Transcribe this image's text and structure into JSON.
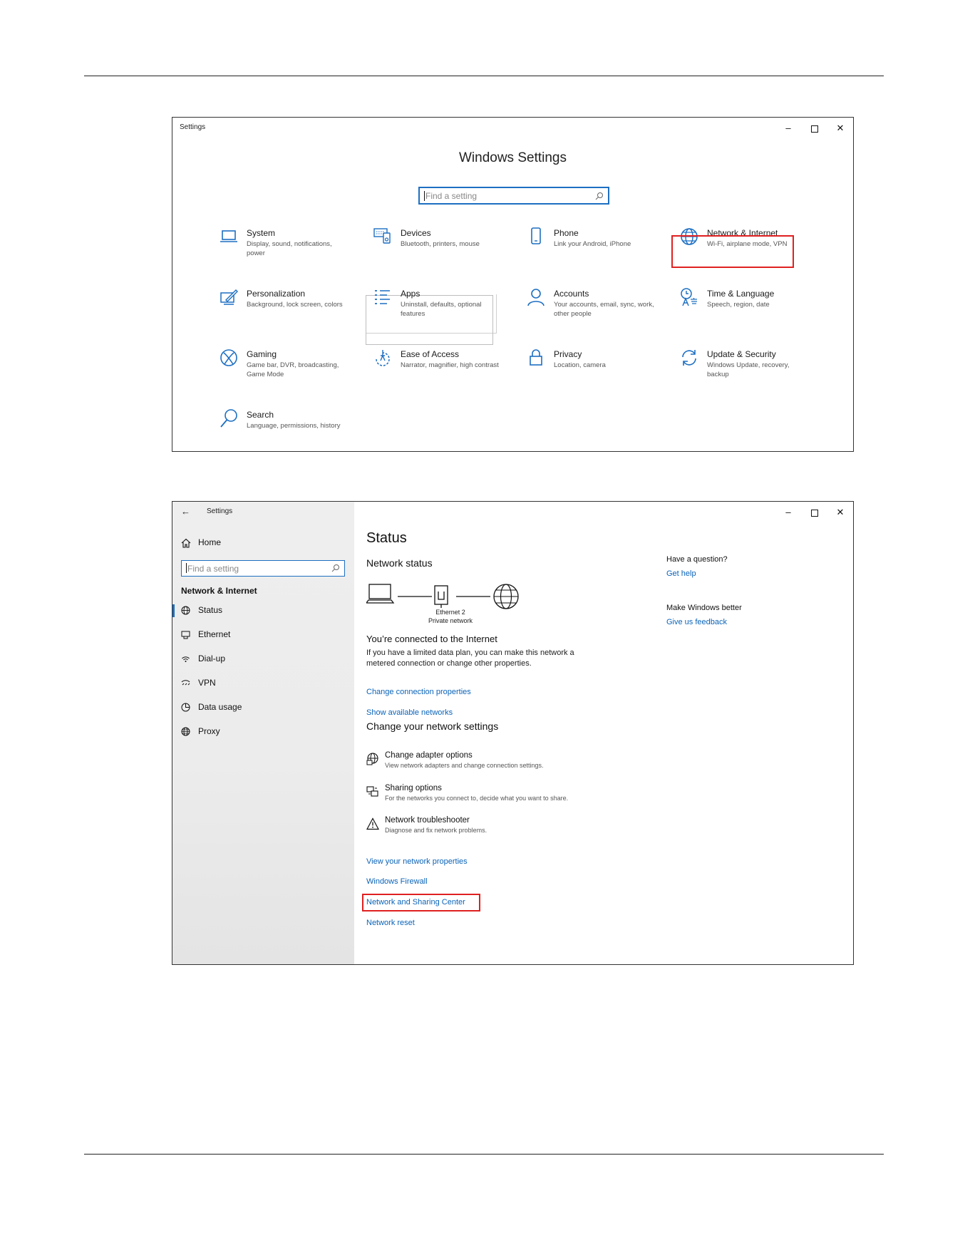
{
  "window1": {
    "title": "Settings",
    "heading": "Windows Settings",
    "search_placeholder": "Find a setting",
    "controls": {
      "minimize": "–",
      "close": "✕"
    },
    "tiles": [
      {
        "name": "System",
        "desc": "Display, sound, notifications, power",
        "icon": "laptop-icon"
      },
      {
        "name": "Devices",
        "desc": "Bluetooth, printers, mouse",
        "icon": "keyboard-icon"
      },
      {
        "name": "Phone",
        "desc": "Link your Android, iPhone",
        "icon": "phone-icon"
      },
      {
        "name": "Network & Internet",
        "desc": "Wi-Fi, airplane mode, VPN",
        "icon": "globe-icon"
      },
      {
        "name": "Personalization",
        "desc": "Background, lock screen, colors",
        "icon": "pen-tablet-icon"
      },
      {
        "name": "Apps",
        "desc": "Uninstall, defaults, optional features",
        "icon": "apps-list-icon"
      },
      {
        "name": "Accounts",
        "desc": "Your accounts, email, sync, work, other people",
        "icon": "person-icon"
      },
      {
        "name": "Time & Language",
        "desc": "Speech, region, date",
        "icon": "time-language-icon"
      },
      {
        "name": "Gaming",
        "desc": "Game bar, DVR, broadcasting, Game Mode",
        "icon": "xbox-icon"
      },
      {
        "name": "Ease of Access",
        "desc": "Narrator, magnifier, high contrast",
        "icon": "ease-of-access-icon"
      },
      {
        "name": "Privacy",
        "desc": "Location, camera",
        "icon": "lock-icon"
      },
      {
        "name": "Update & Security",
        "desc": "Windows Update, recovery, backup",
        "icon": "refresh-icon"
      },
      {
        "name": "Search",
        "desc": "Language, permissions, history",
        "icon": "search-icon"
      }
    ]
  },
  "window2": {
    "title": "Settings",
    "back_glyph": "←",
    "controls": {
      "minimize": "–",
      "close": "✕"
    },
    "sidebar": {
      "home_label": "Home",
      "search_placeholder": "Find a setting",
      "section": "Network & Internet",
      "items": [
        {
          "label": "Status",
          "icon": "status-icon",
          "selected": true
        },
        {
          "label": "Ethernet",
          "icon": "ethernet-icon",
          "selected": false
        },
        {
          "label": "Dial-up",
          "icon": "dialup-icon",
          "selected": false
        },
        {
          "label": "VPN",
          "icon": "vpn-icon",
          "selected": false
        },
        {
          "label": "Data usage",
          "icon": "data-usage-icon",
          "selected": false
        },
        {
          "label": "Proxy",
          "icon": "globe-icon",
          "selected": false
        }
      ]
    },
    "main": {
      "title": "Status",
      "network_status": "Network status",
      "adapter_name": "Ethernet 2",
      "network_type": "Private network",
      "connected": "You’re connected to the Internet",
      "connected_desc": "If you have a limited data plan, you can make this network a metered connection or change other properties.",
      "link_change_props": "Change connection properties",
      "link_show_networks": "Show available networks",
      "change_heading": "Change your network settings",
      "options": [
        {
          "name": "Change adapter options",
          "desc": "View network adapters and change connection settings.",
          "icon": "adapter-globe-icon"
        },
        {
          "name": "Sharing options",
          "desc": "For the networks you connect to, decide what you want to share.",
          "icon": "sharing-icon"
        },
        {
          "name": "Network troubleshooter",
          "desc": "Diagnose and fix network problems.",
          "icon": "warning-icon"
        }
      ],
      "link_view_props": "View your network properties",
      "link_firewall": "Windows Firewall",
      "link_sharing_center": "Network and Sharing Center",
      "link_reset": "Network reset"
    },
    "aside": {
      "question": "Have a question?",
      "help": "Get help",
      "better": "Make Windows better",
      "feedback": "Give us feedback"
    }
  },
  "colors": {
    "accent": "#1d6fc2",
    "link": "#0a63b8",
    "highlight": "#e02020"
  }
}
